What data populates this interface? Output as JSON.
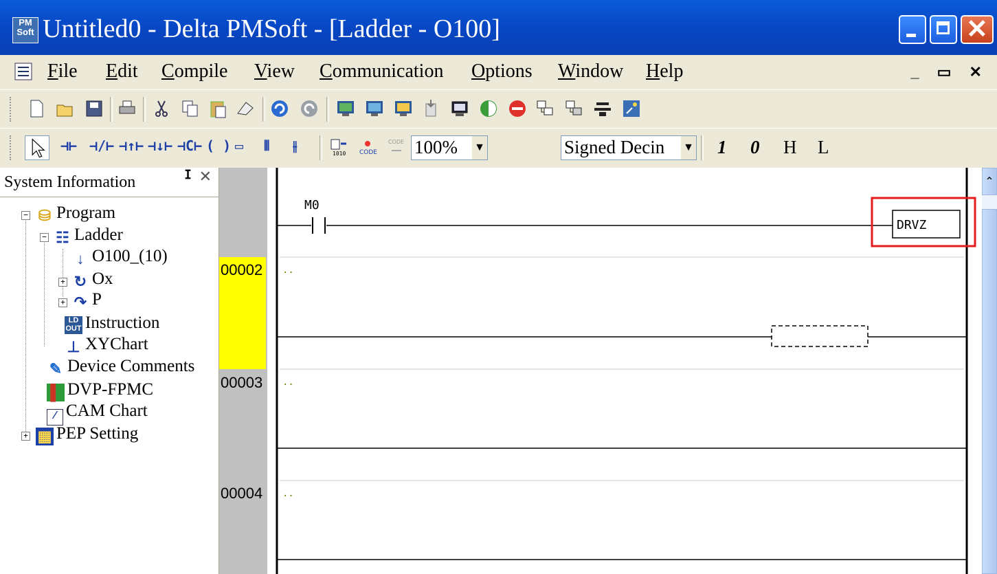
{
  "window": {
    "title": "Untitled0 - Delta PMSoft - [Ladder - O100]",
    "app_icon_text": "PM Soft"
  },
  "menu": {
    "items": [
      "File",
      "Edit",
      "Compile",
      "View",
      "Communication",
      "Options",
      "Window",
      "Help"
    ],
    "mnemonics": [
      "F",
      "E",
      "C",
      "V",
      "C",
      "O",
      "W",
      "H"
    ]
  },
  "toolbar1": {
    "icons": [
      "new-icon",
      "open-icon",
      "save-icon",
      "print-icon",
      "cut-icon",
      "copy-icon",
      "paste-icon",
      "erase-icon",
      "undo-icon",
      "redo-icon",
      "download-icon",
      "upload-icon",
      "monitor-icon",
      "transfer-icon",
      "screen-icon",
      "run-icon",
      "stop-icon",
      "pc-link-icon",
      "pc-link2-icon",
      "online-icon",
      "wizard-icon"
    ]
  },
  "toolbar2": {
    "zoom": "100%",
    "display_format": "Signed Decin",
    "format_buttons": [
      "1",
      "0",
      "H",
      "L"
    ]
  },
  "system_panel": {
    "title": "System Information",
    "tree": [
      {
        "label": "Program",
        "icon": "program-icon"
      },
      {
        "label": "Ladder",
        "icon": "ladder-icon"
      },
      {
        "label": "O100_(10)",
        "icon": "arrow-down-icon"
      },
      {
        "label": "Ox",
        "icon": "refresh-icon"
      },
      {
        "label": "P",
        "icon": "subroutine-icon"
      },
      {
        "label": "Instruction",
        "icon": "instruction-icon"
      },
      {
        "label": "XYChart",
        "icon": "xychart-icon"
      },
      {
        "label": "Device Comments",
        "icon": "comments-icon"
      },
      {
        "label": "DVP-FPMC",
        "icon": "fpmc-icon"
      },
      {
        "label": "CAM Chart",
        "icon": "cam-chart-icon"
      },
      {
        "label": "PEP Setting",
        "icon": "pep-setting-icon"
      }
    ]
  },
  "ladder": {
    "rungs": [
      {
        "number": "",
        "contact": "M0",
        "instruction": "DRVZ"
      },
      {
        "number": "00002",
        "selected": true
      },
      {
        "number": "00003"
      },
      {
        "number": "00004"
      }
    ],
    "empty_marker": ".."
  },
  "colors": {
    "title_bar": "#0a4ed0",
    "selected_rung": "#ffff00",
    "highlight_box": "#e51c1c"
  }
}
